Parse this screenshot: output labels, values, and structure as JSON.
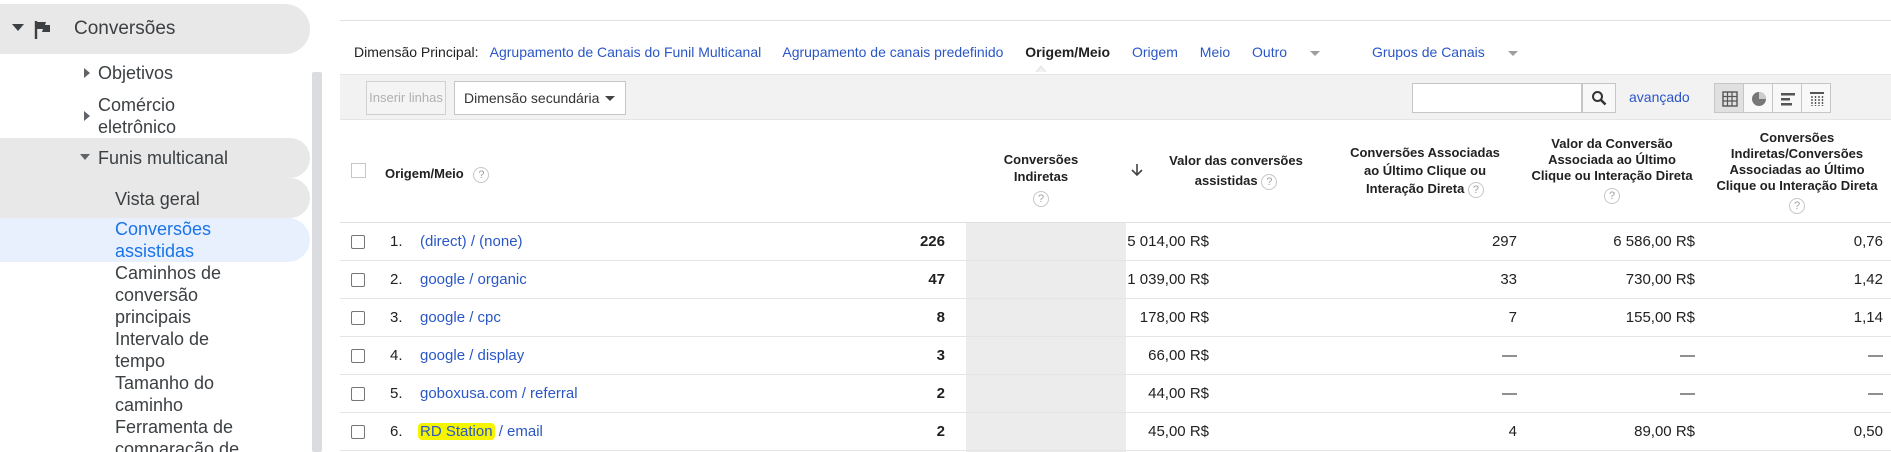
{
  "sidebar": {
    "section_label": "Conversões",
    "items": [
      {
        "label": "Objetivos"
      },
      {
        "label": "Comércio eletrônico",
        "line1": "Comércio",
        "line2": "eletrônico"
      },
      {
        "label": "Funis multicanal"
      }
    ],
    "sub_items": [
      {
        "line1": "Vista geral"
      },
      {
        "line1": "Conversões",
        "line2": "assistidas"
      },
      {
        "line1": "Caminhos de",
        "line2": "conversão",
        "line3": "principais"
      },
      {
        "line1": "Intervalo de",
        "line2": "tempo"
      },
      {
        "line1": "Tamanho do",
        "line2": "caminho"
      },
      {
        "line1": "Ferramenta de",
        "line2": "comparação de"
      }
    ]
  },
  "dimension_bar": {
    "label": "Dimensão Principal:",
    "options": [
      "Agrupamento de Canais do Funil Multicanal",
      "Agrupamento de canais predefinido",
      "Origem/Meio",
      "Origem",
      "Meio",
      "Outro",
      "Grupos de Canais"
    ],
    "active": "Origem/Meio"
  },
  "toolbar": {
    "insert_rows_label": "Inserir linhas",
    "secondary_dimension_label": "Dimensão secundária",
    "search_value": "",
    "advanced_label": "avançado",
    "view_icons": [
      "table-view-icon",
      "pie-view-icon",
      "bar-view-icon",
      "pivot-view-icon"
    ]
  },
  "table": {
    "headers": {
      "source_medium": "Origem/Meio",
      "indirect_conversions": "Conversões Indiretas",
      "assisted_value_l1": "Valor das conversões",
      "assisted_value_l2": "assistidas",
      "last_click_conv_l1": "Conversões Associadas",
      "last_click_conv_l2": "ao Último Clique ou",
      "last_click_conv_l3": "Interação Direta",
      "last_click_value_l1": "Valor da Conversão",
      "last_click_value_l2": "Associada ao Último",
      "last_click_value_l3": "Clique ou Interação Direta",
      "ratio_l1": "Conversões",
      "ratio_l2": "Indiretas/Conversões",
      "ratio_l3": "Associadas ao Último",
      "ratio_l4": "Clique ou Interação Direta",
      "help_glyph": "?"
    },
    "rows": [
      {
        "idx": "1.",
        "source": "(direct) / (none)",
        "highlight": "",
        "rest": "",
        "indirect": "226",
        "assisted_value": "5 014,00 R$",
        "last_click": "297",
        "last_click_value": "6 586,00 R$",
        "ratio": "0,76"
      },
      {
        "idx": "2.",
        "source": "google / organic",
        "highlight": "",
        "rest": "",
        "indirect": "47",
        "assisted_value": "1 039,00 R$",
        "last_click": "33",
        "last_click_value": "730,00 R$",
        "ratio": "1,42"
      },
      {
        "idx": "3.",
        "source": "google / cpc",
        "highlight": "",
        "rest": "",
        "indirect": "8",
        "assisted_value": "178,00 R$",
        "last_click": "7",
        "last_click_value": "155,00 R$",
        "ratio": "1,14"
      },
      {
        "idx": "4.",
        "source": "google / display",
        "highlight": "",
        "rest": "",
        "indirect": "3",
        "assisted_value": "66,00 R$",
        "last_click": "—",
        "last_click_value": "—",
        "ratio": "—"
      },
      {
        "idx": "5.",
        "source": "goboxusa.com / referral",
        "highlight": "",
        "rest": "",
        "indirect": "2",
        "assisted_value": "44,00 R$",
        "last_click": "—",
        "last_click_value": "—",
        "ratio": "—"
      },
      {
        "idx": "6.",
        "source": "",
        "highlight": "RD Station",
        "rest": " / email",
        "indirect": "2",
        "assisted_value": "45,00 R$",
        "last_click": "4",
        "last_click_value": "89,00 R$",
        "ratio": "0,50"
      }
    ]
  },
  "colors": {
    "link": "#2a56c6",
    "sidebar_selected": "#e8f0fe",
    "highlight": "#f5f500"
  }
}
